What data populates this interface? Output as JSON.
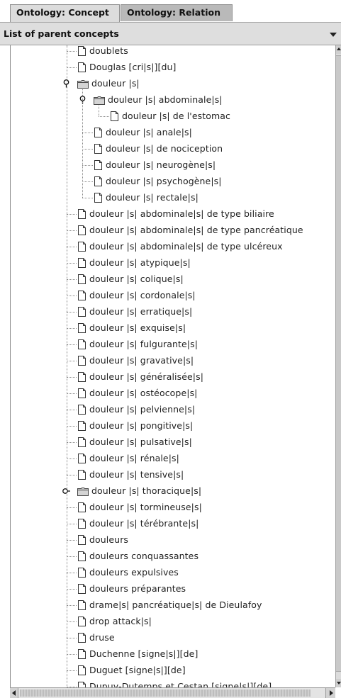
{
  "tabs": [
    {
      "label": "Ontology: Concept",
      "active": true
    },
    {
      "label": "Ontology: Relation",
      "active": false
    }
  ],
  "header": {
    "title": "List of parent concepts"
  },
  "colors": {
    "tab_active": "#dcdcdc",
    "tab_inactive": "#b9b9b9",
    "header_bg": "#dedede",
    "tree_line": "#8a8a8a"
  },
  "tree": [
    {
      "label": "doublets",
      "depth": 1,
      "type": "leaf"
    },
    {
      "label": "Douglas [cri|s|][du]",
      "depth": 1,
      "type": "leaf"
    },
    {
      "label": "douleur |s|",
      "depth": 1,
      "type": "folder",
      "expanded": true
    },
    {
      "label": "douleur |s| abdominale|s|",
      "depth": 2,
      "type": "folder",
      "expanded": true
    },
    {
      "label": "douleur |s| de l'estomac",
      "depth": 3,
      "type": "leaf"
    },
    {
      "label": "douleur |s| anale|s|",
      "depth": 2,
      "type": "leaf"
    },
    {
      "label": "douleur |s| de nociception",
      "depth": 2,
      "type": "leaf"
    },
    {
      "label": "douleur |s| neurogène|s|",
      "depth": 2,
      "type": "leaf"
    },
    {
      "label": "douleur |s| psychogène|s|",
      "depth": 2,
      "type": "leaf"
    },
    {
      "label": "douleur |s| rectale|s|",
      "depth": 2,
      "type": "leaf"
    },
    {
      "label": "douleur |s| abdominale|s| de type biliaire",
      "depth": 1,
      "type": "leaf"
    },
    {
      "label": "douleur |s| abdominale|s| de type pancréatique",
      "depth": 1,
      "type": "leaf"
    },
    {
      "label": "douleur |s| abdominale|s| de type ulcéreux",
      "depth": 1,
      "type": "leaf"
    },
    {
      "label": "douleur |s| atypique|s|",
      "depth": 1,
      "type": "leaf"
    },
    {
      "label": "douleur |s| colique|s|",
      "depth": 1,
      "type": "leaf"
    },
    {
      "label": "douleur |s| cordonale|s|",
      "depth": 1,
      "type": "leaf"
    },
    {
      "label": "douleur |s| erratique|s|",
      "depth": 1,
      "type": "leaf"
    },
    {
      "label": "douleur |s| exquise|s|",
      "depth": 1,
      "type": "leaf"
    },
    {
      "label": "douleur |s| fulgurante|s|",
      "depth": 1,
      "type": "leaf"
    },
    {
      "label": "douleur |s| gravative|s|",
      "depth": 1,
      "type": "leaf"
    },
    {
      "label": "douleur |s| généralisée|s|",
      "depth": 1,
      "type": "leaf"
    },
    {
      "label": "douleur |s| ostéocope|s|",
      "depth": 1,
      "type": "leaf"
    },
    {
      "label": "douleur |s| pelvienne|s|",
      "depth": 1,
      "type": "leaf"
    },
    {
      "label": "douleur |s| pongitive|s|",
      "depth": 1,
      "type": "leaf"
    },
    {
      "label": "douleur |s| pulsative|s|",
      "depth": 1,
      "type": "leaf"
    },
    {
      "label": "douleur |s| rénale|s|",
      "depth": 1,
      "type": "leaf"
    },
    {
      "label": "douleur |s| tensive|s|",
      "depth": 1,
      "type": "leaf"
    },
    {
      "label": "douleur |s| thoracique|s|",
      "depth": 1,
      "type": "folder",
      "expanded": false
    },
    {
      "label": "douleur |s| tormineuse|s|",
      "depth": 1,
      "type": "leaf"
    },
    {
      "label": "douleur |s| térébrante|s|",
      "depth": 1,
      "type": "leaf"
    },
    {
      "label": "douleurs",
      "depth": 1,
      "type": "leaf"
    },
    {
      "label": "douleurs conquassantes",
      "depth": 1,
      "type": "leaf"
    },
    {
      "label": "douleurs expulsives",
      "depth": 1,
      "type": "leaf"
    },
    {
      "label": "douleurs préparantes",
      "depth": 1,
      "type": "leaf"
    },
    {
      "label": "drame|s| pancréatique|s| de Dieulafoy",
      "depth": 1,
      "type": "leaf"
    },
    {
      "label": "drop attack|s|",
      "depth": 1,
      "type": "leaf"
    },
    {
      "label": "druse",
      "depth": 1,
      "type": "leaf"
    },
    {
      "label": "Duchenne [signe|s|][de]",
      "depth": 1,
      "type": "leaf"
    },
    {
      "label": "Duguet [signe|s|][de]",
      "depth": 1,
      "type": "leaf"
    },
    {
      "label": "Dupuy-Dutemps et Cestan [signe|s|][de]",
      "depth": 1,
      "type": "leaf"
    }
  ],
  "icons": {
    "leaf": "document-icon",
    "folder": "folder-icon",
    "expanded_handle": "expanded-handle-icon",
    "collapsed_handle": "collapsed-handle-icon",
    "dropdown": "dropdown-arrow-icon"
  }
}
